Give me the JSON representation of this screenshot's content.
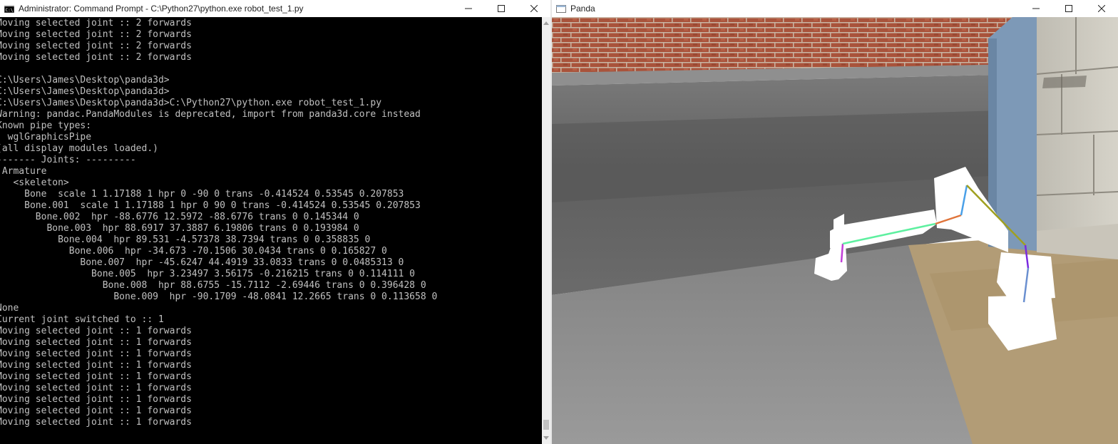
{
  "console_window": {
    "title": "Administrator: Command Prompt - C:\\Python27\\python.exe  robot_test_1.py",
    "icon": "cmd-icon",
    "controls": {
      "minimize": "—",
      "maximize": "☐",
      "close": "✕"
    },
    "lines": [
      "Moving selected joint :: 2 forwards",
      "Moving selected joint :: 2 forwards",
      "Moving selected joint :: 2 forwards",
      "Moving selected joint :: 2 forwards",
      "",
      "C:\\Users\\James\\Desktop\\panda3d>",
      "C:\\Users\\James\\Desktop\\panda3d>",
      "C:\\Users\\James\\Desktop\\panda3d>C:\\Python27\\python.exe robot_test_1.py",
      "Warning: pandac.PandaModules is deprecated, import from panda3d.core instead",
      "Known pipe types:",
      "  wglGraphicsPipe",
      "(all display modules loaded.)",
      "------- Joints: ---------",
      " Armature",
      "   <skeleton>",
      "     Bone  scale 1 1.17188 1 hpr 0 -90 0 trans -0.414524 0.53545 0.207853",
      "     Bone.001  scale 1 1.17188 1 hpr 0 90 0 trans -0.414524 0.53545 0.207853",
      "       Bone.002  hpr -88.6776 12.5972 -88.6776 trans 0 0.145344 0",
      "         Bone.003  hpr 88.6917 37.3887 6.19806 trans 0 0.193984 0",
      "           Bone.004  hpr 89.531 -4.57378 38.7394 trans 0 0.358835 0",
      "             Bone.006  hpr -34.673 -70.1506 30.0434 trans 0 0.165827 0",
      "               Bone.007  hpr -45.6247 44.4919 33.0833 trans 0 0.0485313 0",
      "                 Bone.005  hpr 3.23497 3.56175 -0.216215 trans 0 0.114111 0",
      "                   Bone.008  hpr 88.6755 -15.7112 -2.69446 trans 0 0.396428 0",
      "                     Bone.009  hpr -90.1709 -48.0841 12.2665 trans 0 0.113658 0",
      "None",
      "Current joint switched to :: 1",
      "Moving selected joint :: 1 forwards",
      "Moving selected joint :: 1 forwards",
      "Moving selected joint :: 1 forwards",
      "Moving selected joint :: 1 forwards",
      "Moving selected joint :: 1 forwards",
      "Moving selected joint :: 1 forwards",
      "Moving selected joint :: 1 forwards",
      "Moving selected joint :: 1 forwards",
      "Moving selected joint :: 1 forwards"
    ],
    "scrollbar": {
      "up_icon": "arrow-up-icon",
      "down_icon": "arrow-down-icon",
      "position": 0.97
    }
  },
  "panda_window": {
    "title": "Panda",
    "icon": "panda-window-icon",
    "controls": {
      "minimize": "—",
      "maximize": "☐",
      "close": "✕"
    },
    "scene": {
      "description_colors": {
        "brick": "#b0553c",
        "road": "#6e6e6e",
        "sidewalk": "#8c8c8c",
        "sand": "#b49e78",
        "pillar": "#7f9bb8",
        "robot": "#ffffff"
      },
      "bone_colors": [
        "#c23fd8",
        "#5ef0a0",
        "#e0743a",
        "#4aa0e8",
        "#a0a020",
        "#7a2ae0",
        "#6a8fd0"
      ]
    }
  }
}
